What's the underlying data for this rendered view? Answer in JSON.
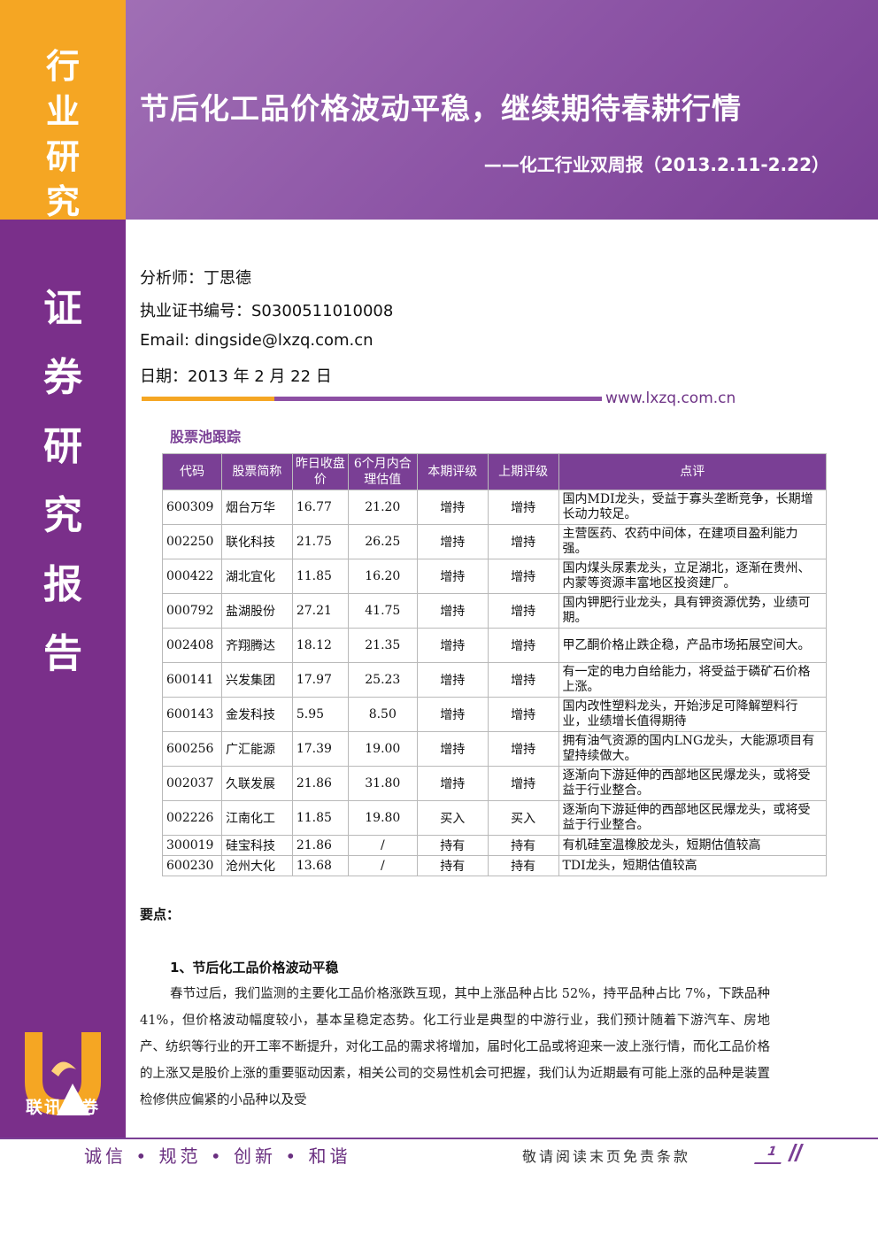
{
  "sidebar": {
    "industry_label": [
      "行",
      "业",
      "研",
      "究"
    ],
    "report_label": [
      "证",
      "券",
      "研",
      "究",
      "报",
      "告"
    ],
    "brand": "联讯证券"
  },
  "header": {
    "title": "节后化工品价格波动平稳，继续期待春耕行情",
    "subtitle": "——化工行业双周报（2013.2.11-2.22）"
  },
  "meta": {
    "analyst": "分析师：丁思德",
    "license": "执业证书编号：S0300511010008",
    "email": "Email: dingside@lxzq.com.cn",
    "date": "日期：2013 年 2 月 22 日",
    "website": "www.lxzq.com.cn"
  },
  "stock_pool": {
    "title": "股票池跟踪",
    "headers": [
      "代码",
      "股票简称",
      "昨日收盘价",
      "6个月内合理估值",
      "本期评级",
      "上期评级",
      "点评"
    ],
    "rows": [
      {
        "code": "600309",
        "name": "烟台万华",
        "close": "16.77",
        "target": "21.20",
        "rating": "增持",
        "prev_rating": "增持",
        "comment": "国内MDI龙头，受益于寡头垄断竞争，长期增长动力较足。"
      },
      {
        "code": "002250",
        "name": "联化科技",
        "close": "21.75",
        "target": "26.25",
        "rating": "增持",
        "prev_rating": "增持",
        "comment": "主营医药、农药中间体，在建项目盈利能力强。"
      },
      {
        "code": "000422",
        "name": "湖北宜化",
        "close": "11.85",
        "target": "16.20",
        "rating": "增持",
        "prev_rating": "增持",
        "comment": "国内煤头尿素龙头，立足湖北，逐渐在贵州、内蒙等资源丰富地区投资建厂。"
      },
      {
        "code": "000792",
        "name": "盐湖股份",
        "close": "27.21",
        "target": "41.75",
        "rating": "增持",
        "prev_rating": "增持",
        "comment": "国内钾肥行业龙头，具有钾资源优势，业绩可期。"
      },
      {
        "code": "002408",
        "name": "齐翔腾达",
        "close": "18.12",
        "target": "21.35",
        "rating": "增持",
        "prev_rating": "增持",
        "comment": "甲乙酮价格止跌企稳，产品市场拓展空间大。"
      },
      {
        "code": "600141",
        "name": "兴发集团",
        "close": "17.97",
        "target": "25.23",
        "rating": "增持",
        "prev_rating": "增持",
        "comment": "有一定的电力自给能力，将受益于磷矿石价格上涨。"
      },
      {
        "code": "600143",
        "name": "金发科技",
        "close": "5.95",
        "target": "8.50",
        "rating": "增持",
        "prev_rating": "增持",
        "comment": "国内改性塑料龙头，开始涉足可降解塑料行业，业绩增长值得期待"
      },
      {
        "code": "600256",
        "name": "广汇能源",
        "close": "17.39",
        "target": "19.00",
        "rating": "增持",
        "prev_rating": "增持",
        "comment": "拥有油气资源的国内LNG龙头，大能源项目有望持续做大。"
      },
      {
        "code": "002037",
        "name": "久联发展",
        "close": "21.86",
        "target": "31.80",
        "rating": "增持",
        "prev_rating": "增持",
        "comment": "逐渐向下游延伸的西部地区民爆龙头，或将受益于行业整合。"
      },
      {
        "code": "002226",
        "name": "江南化工",
        "close": "11.85",
        "target": "19.80",
        "rating": "买入",
        "prev_rating": "买入",
        "comment": "逐渐向下游延伸的西部地区民爆龙头，或将受益于行业整合。"
      },
      {
        "code": "300019",
        "name": "硅宝科技",
        "close": "21.86",
        "target": "/",
        "rating": "持有",
        "prev_rating": "持有",
        "comment": "有机硅室温橡胶龙头，短期估值较高"
      },
      {
        "code": "600230",
        "name": "沧州大化",
        "close": "13.68",
        "target": "/",
        "rating": "持有",
        "prev_rating": "持有",
        "comment": "TDI龙头，短期估值较高"
      }
    ]
  },
  "body": {
    "keypoints_label": "要点：",
    "section1_title": "1、节后化工品价格波动平稳",
    "section1_text": "春节过后，我们监测的主要化工品价格涨跌互现，其中上涨品种占比 52%，持平品种占比 7%，下跌品种 41%，但价格波动幅度较小，基本呈稳定态势。化工行业是典型的中游行业，我们预计随着下游汽车、房地产、纺织等行业的开工率不断提升，对化工品的需求将增加，届时化工品或将迎来一波上涨行情，而化工品价格的上涨又是股价上涨的重要驱动因素，相关公司的交易性机会可把握，我们认为近期最有可能上涨的品种是装置检修供应偏紧的小品种以及受"
  },
  "footer": {
    "motto": "诚信 • 规范 • 创新 • 和谐",
    "disclaimer": "敬请阅读末页免责条款",
    "page": "1"
  },
  "colors": {
    "purple": "#7a3f95",
    "orange": "#f5a623"
  }
}
